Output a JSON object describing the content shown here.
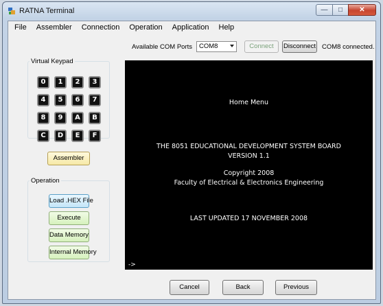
{
  "window": {
    "title": "RATNA Terminal"
  },
  "menu": [
    "File",
    "Assembler",
    "Connection",
    "Operation",
    "Application",
    "Help"
  ],
  "toolbar": {
    "com_label": "Available COM Ports",
    "com_value": "COM8",
    "connect_label": "Connect",
    "disconnect_label": "Disconnect",
    "status": "COM8 connected."
  },
  "keypad": {
    "title": "Virtual Keypad",
    "keys": [
      "0",
      "1",
      "2",
      "3",
      "4",
      "5",
      "6",
      "7",
      "8",
      "9",
      "A",
      "B",
      "C",
      "D",
      "E",
      "F"
    ]
  },
  "assembler_button": "Assembler",
  "operation": {
    "title": "Operation",
    "buttons": [
      "Load .HEX File",
      "Execute",
      "Data Memory",
      "Internal Memory"
    ]
  },
  "terminal": {
    "lines": [
      "Home Menu",
      "THE 8051 EDUCATIONAL DEVELOPMENT SYSTEM BOARD",
      "VERSION 1.1",
      "Copyright 2008",
      "Faculty of Electrical & Electronics Engineering",
      "LAST UPDATED 17 NOVEMBER 2008"
    ],
    "prompt": "->"
  },
  "bottom_buttons": [
    "Cancel",
    "Back",
    "Previous"
  ],
  "colors": {
    "terminal_bg": "#000000",
    "terminal_fg": "#ffffff",
    "close_button": "#c7452f"
  }
}
